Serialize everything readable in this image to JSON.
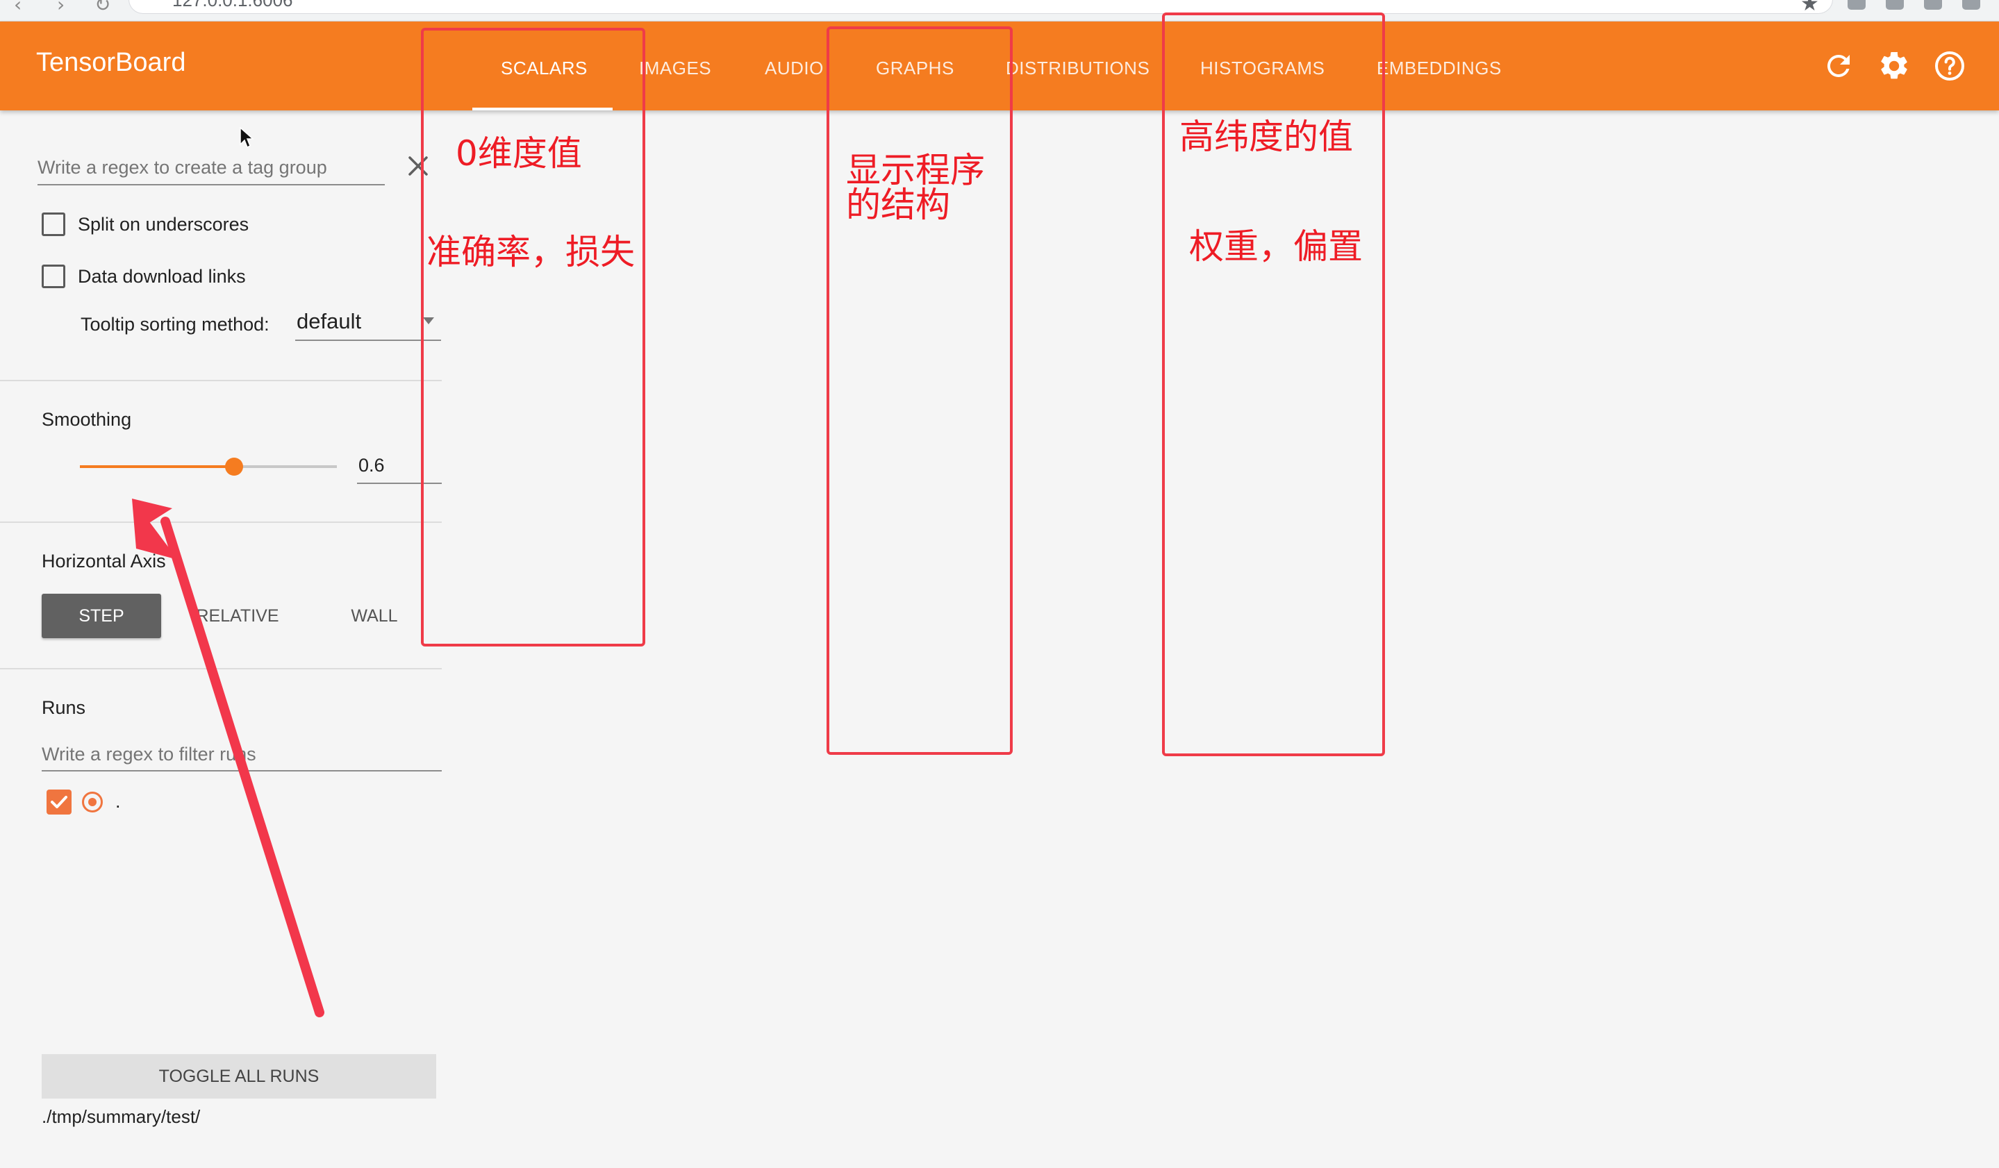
{
  "browser": {
    "url": "127.0.0.1:6006"
  },
  "app": {
    "title": "TensorBoard",
    "accent_color": "#f57c20"
  },
  "tabs": [
    {
      "label": "SCALARS",
      "active": true
    },
    {
      "label": "IMAGES",
      "active": false
    },
    {
      "label": "AUDIO",
      "active": false
    },
    {
      "label": "GRAPHS",
      "active": false
    },
    {
      "label": "DISTRIBUTIONS",
      "active": false
    },
    {
      "label": "HISTOGRAMS",
      "active": false
    },
    {
      "label": "EMBEDDINGS",
      "active": false
    }
  ],
  "toolbar_icons": [
    "refresh-icon",
    "settings-gear-icon",
    "help-icon"
  ],
  "sidebar": {
    "tag_regex_placeholder": "Write a regex to create a tag group",
    "split_underscores_label": "Split on underscores",
    "split_underscores_checked": false,
    "data_download_label": "Data download links",
    "data_download_checked": false,
    "tooltip_sort_label": "Tooltip sorting method:",
    "tooltip_sort_value": "default",
    "smoothing_title": "Smoothing",
    "smoothing_value": "0.6",
    "smoothing_fraction": 0.6,
    "horizontal_axis_title": "Horizontal Axis",
    "axis_options": [
      {
        "label": "STEP",
        "active": true
      },
      {
        "label": "RELATIVE",
        "active": false
      },
      {
        "label": "WALL",
        "active": false
      }
    ],
    "runs_title": "Runs",
    "runs_filter_placeholder": "Write a regex to filter runs",
    "runs": [
      {
        "label": ".",
        "checked": true,
        "color": "#f0753f"
      }
    ],
    "toggle_all_label": "TOGGLE ALL RUNS",
    "logdir_path": "./tmp/summary/test/"
  },
  "annotations": {
    "color": "#ee1c25",
    "scalars_note_1": "0维度值",
    "scalars_note_2": "准确率，损失",
    "graphs_note_line1": "显示程序",
    "graphs_note_line2": "的结构",
    "histograms_note_1": "高纬度的值",
    "histograms_note_2": "权重，偏置"
  }
}
